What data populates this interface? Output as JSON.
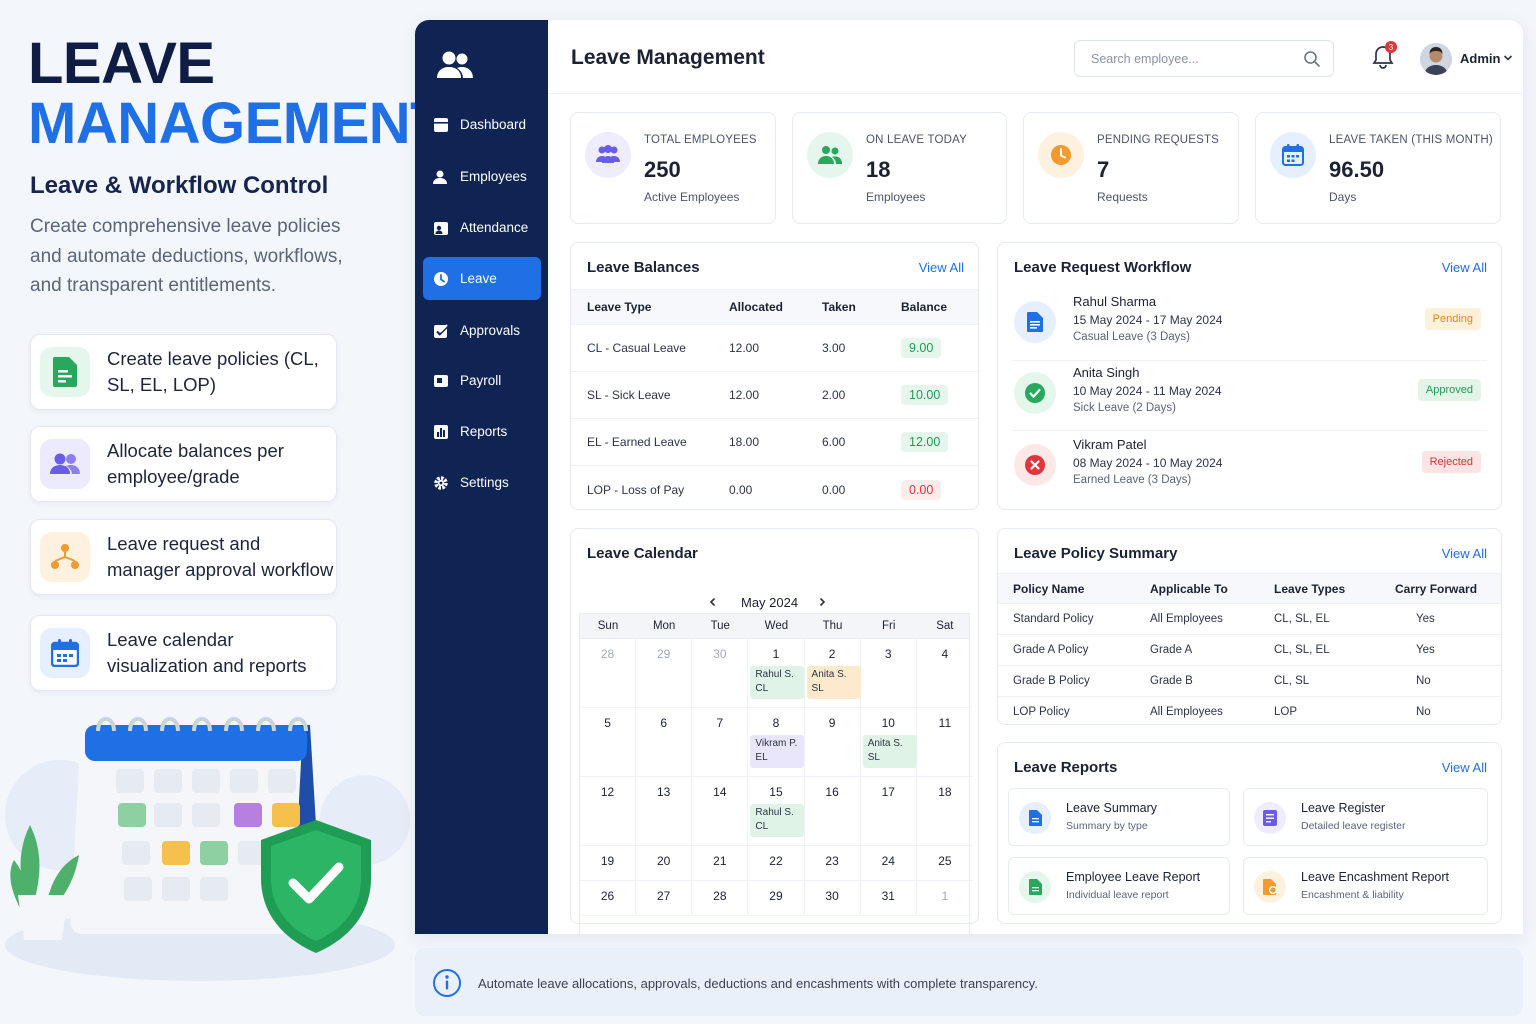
{
  "promo": {
    "title_line1": "LEAVE",
    "title_line2": "MANAGEMENT",
    "subtitle": "Leave & Workflow Control",
    "description": "Create comprehensive leave policies and automate deductions, workflows, and transparent entitlements.",
    "features": [
      {
        "icon": "policy-document-icon",
        "text": "Create leave policies (CL, SL, EL, LOP)",
        "color": "#28a85c"
      },
      {
        "icon": "users-icon",
        "text": "Allocate balances per employee/grade",
        "color": "#6b5ce7"
      },
      {
        "icon": "workflow-icon",
        "text": "Leave request and manager approval workflow",
        "color": "#f29a2e"
      },
      {
        "icon": "calendar-icon",
        "text": "Leave calendar visualization and reports",
        "color": "#1f6fe5"
      }
    ]
  },
  "sidebar": {
    "items": [
      {
        "label": "Dashboard",
        "icon": "dashboard-icon"
      },
      {
        "label": "Employees",
        "icon": "employee-icon"
      },
      {
        "label": "Attendance",
        "icon": "attendance-icon"
      },
      {
        "label": "Leave",
        "icon": "leave-icon",
        "active": true
      },
      {
        "label": "Approvals",
        "icon": "approvals-icon"
      },
      {
        "label": "Payroll",
        "icon": "payroll-icon"
      },
      {
        "label": "Reports",
        "icon": "reports-icon"
      },
      {
        "label": "Settings",
        "icon": "settings-icon"
      }
    ]
  },
  "header": {
    "title": "Leave Management",
    "search_placeholder": "Search employee...",
    "notification_count": "3",
    "user_name": "Admin"
  },
  "stats": [
    {
      "label": "TOTAL EMPLOYEES",
      "value": "250",
      "sub": "Active Employees",
      "color": "#6b5ce7"
    },
    {
      "label": "ON LEAVE TODAY",
      "value": "18",
      "sub": "Employees",
      "color": "#28a85c"
    },
    {
      "label": "PENDING REQUESTS",
      "value": "7",
      "sub": "Requests",
      "color": "#f29a2e"
    },
    {
      "label": "LEAVE TAKEN (THIS MONTH)",
      "value": "96.50",
      "sub": "Days",
      "color": "#1f6fe5"
    }
  ],
  "balances": {
    "title": "Leave Balances",
    "view_all": "View All",
    "columns": [
      "Leave Type",
      "Allocated",
      "Taken",
      "Balance"
    ],
    "rows": [
      {
        "type": "CL - Casual Leave",
        "allocated": "12.00",
        "taken": "3.00",
        "balance": "9.00",
        "color": "#1f9d55"
      },
      {
        "type": "SL - Sick Leave",
        "allocated": "12.00",
        "taken": "2.00",
        "balance": "10.00",
        "color": "#1f9d55"
      },
      {
        "type": "EL - Earned Leave",
        "allocated": "18.00",
        "taken": "6.00",
        "balance": "12.00",
        "color": "#1f9d55"
      },
      {
        "type": "LOP - Loss of Pay",
        "allocated": "0.00",
        "taken": "0.00",
        "balance": "0.00",
        "color": "#e0363b"
      }
    ]
  },
  "workflow": {
    "title": "Leave Request Workflow",
    "view_all": "View All",
    "items": [
      {
        "name": "Rahul Sharma",
        "dates": "15 May 2024 - 17 May 2024",
        "type": "Casual Leave (3 Days)",
        "status": "Pending",
        "icon": "document-icon"
      },
      {
        "name": "Anita Singh",
        "dates": "10 May 2024 - 11 May 2024",
        "type": "Sick Leave (2 Days)",
        "status": "Approved",
        "icon": "check-icon"
      },
      {
        "name": "Vikram Patel",
        "dates": "08 May 2024 - 10 May 2024",
        "type": "Earned Leave (3 Days)",
        "status": "Rejected",
        "icon": "close-icon"
      }
    ]
  },
  "calendar": {
    "title": "Leave Calendar",
    "month": "May 2024",
    "weekdays": [
      "Sun",
      "Mon",
      "Tue",
      "Wed",
      "Thu",
      "Fri",
      "Sat"
    ],
    "weeks": [
      [
        {
          "d": "28",
          "m": true
        },
        {
          "d": "29",
          "m": true
        },
        {
          "d": "30",
          "m": true
        },
        {
          "d": "1",
          "ev": {
            "name": "Rahul S.",
            "code": "CL",
            "color": "#dff3e6"
          }
        },
        {
          "d": "2",
          "ev": {
            "name": "Anita S.",
            "code": "SL",
            "color": "#fde9cc"
          }
        },
        {
          "d": "3"
        },
        {
          "d": "4"
        }
      ],
      [
        {
          "d": "5"
        },
        {
          "d": "6"
        },
        {
          "d": "7"
        },
        {
          "d": "8",
          "ev": {
            "name": "Vikram P.",
            "code": "EL",
            "color": "#e9e5fb"
          }
        },
        {
          "d": "9"
        },
        {
          "d": "10",
          "ev": {
            "name": "Anita S.",
            "code": "SL",
            "color": "#dff3e6"
          }
        },
        {
          "d": "11"
        }
      ],
      [
        {
          "d": "12"
        },
        {
          "d": "13"
        },
        {
          "d": "14"
        },
        {
          "d": "15",
          "ev": {
            "name": "Rahul S.",
            "code": "CL",
            "color": "#dff3e6"
          }
        },
        {
          "d": "16"
        },
        {
          "d": "17"
        },
        {
          "d": "18"
        }
      ],
      [
        {
          "d": "19"
        },
        {
          "d": "20"
        },
        {
          "d": "21"
        },
        {
          "d": "22"
        },
        {
          "d": "23"
        },
        {
          "d": "24"
        },
        {
          "d": "25"
        }
      ],
      [
        {
          "d": "26"
        },
        {
          "d": "27"
        },
        {
          "d": "28"
        },
        {
          "d": "29"
        },
        {
          "d": "30"
        },
        {
          "d": "31"
        },
        {
          "d": "1",
          "m": true
        }
      ]
    ]
  },
  "policy": {
    "title": "Leave Policy Summary",
    "view_all": "View All",
    "columns": [
      "Policy Name",
      "Applicable To",
      "Leave Types",
      "Carry Forward"
    ],
    "rows": [
      [
        "Standard Policy",
        "All Employees",
        "CL, SL, EL",
        "Yes"
      ],
      [
        "Grade A Policy",
        "Grade A",
        "CL, SL, EL",
        "Yes"
      ],
      [
        "Grade B Policy",
        "Grade B",
        "CL, SL",
        "No"
      ],
      [
        "LOP Policy",
        "All Employees",
        "LOP",
        "No"
      ]
    ]
  },
  "reports": {
    "title": "Leave Reports",
    "view_all": "View All",
    "items": [
      {
        "name": "Leave Summary",
        "desc": "Summary by type",
        "color": "#1f6fe5"
      },
      {
        "name": "Leave Register",
        "desc": "Detailed leave register",
        "color": "#6b5ce7"
      },
      {
        "name": "Employee Leave Report",
        "desc": "Individual leave report",
        "color": "#28a85c"
      },
      {
        "name": "Leave Encashment Report",
        "desc": "Encashment & liability",
        "color": "#f29a2e"
      }
    ]
  },
  "footer": {
    "text": "Automate leave allocations, approvals, deductions and encashments with complete transparency."
  }
}
